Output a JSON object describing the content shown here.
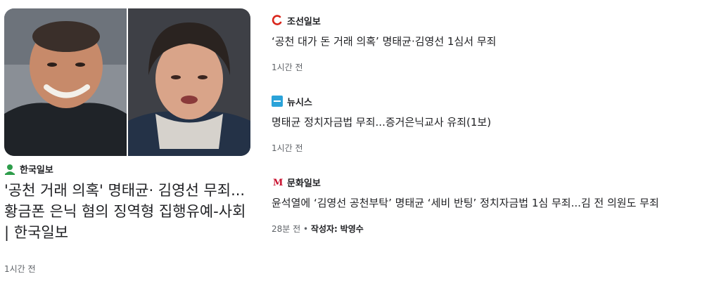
{
  "main": {
    "source": "한국일보",
    "title": "'공천 거래 의혹' 명태균· 김영선 무죄... 황금폰 은닉 혐의 징역형 집행유예-사회 | 한국일보",
    "time": "1시간 전",
    "image_alt": "명태균 김영선 사진"
  },
  "side": [
    {
      "source": "조선일보",
      "title": "‘공천 대가 돈 거래 의혹’ 명태균·김영선 1심서 무죄",
      "time": "1시간 전",
      "logo_color": "#d9261c"
    },
    {
      "source": "뉴시스",
      "title": "명태균 정치자금법 무죄...증거은닉교사 유죄(1보)",
      "time": "1시간 전",
      "logo_color": "#2ba3d9"
    },
    {
      "source": "문화일보",
      "title": "윤석열에 ‘김영선 공천부탁’ 명태균 ‘세비 반팅’ 정치자금법 1심 무죄...김 전 의원도 무죄",
      "time": "28분 전",
      "author_prefix": "작성자:",
      "author": "박영수",
      "logo_color": "#c8102e"
    }
  ],
  "colors": {
    "text": "#202124",
    "muted": "#5f6368",
    "hankook_logo": "#2e9d4b"
  }
}
